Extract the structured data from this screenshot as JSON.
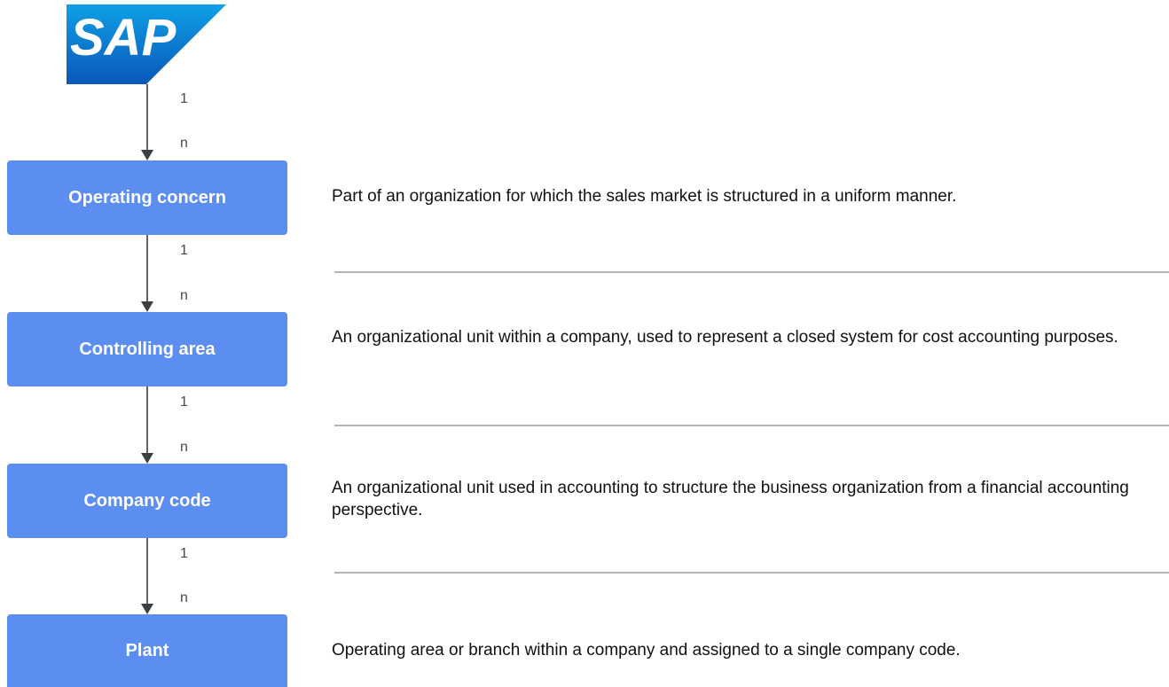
{
  "logo": {
    "text": "SAP",
    "colors": {
      "top": "#0fa0e6",
      "bottom": "#0a57b8",
      "text": "#ffffff"
    }
  },
  "colors": {
    "box": "#5b8ef0",
    "box_text": "#ffffff",
    "arrow": "#5f6368",
    "divider": "#b5b5b5"
  },
  "connectors": [
    {
      "from": "1",
      "to": "n"
    },
    {
      "from": "1",
      "to": "n"
    },
    {
      "from": "1",
      "to": "n"
    },
    {
      "from": "1",
      "to": "n"
    }
  ],
  "units": [
    {
      "name": "Operating concern",
      "description": "Part of an organization for which the sales market is structured in a uniform manner."
    },
    {
      "name": "Controlling area",
      "description": "An organizational unit within a company, used to represent a closed system for cost accounting purposes."
    },
    {
      "name": "Company code",
      "description": "An organizational unit used in accounting to structure the business organization from a financial accounting perspective."
    },
    {
      "name": "Plant",
      "description": "Operating area or branch within a company and assigned to a single company code."
    }
  ]
}
